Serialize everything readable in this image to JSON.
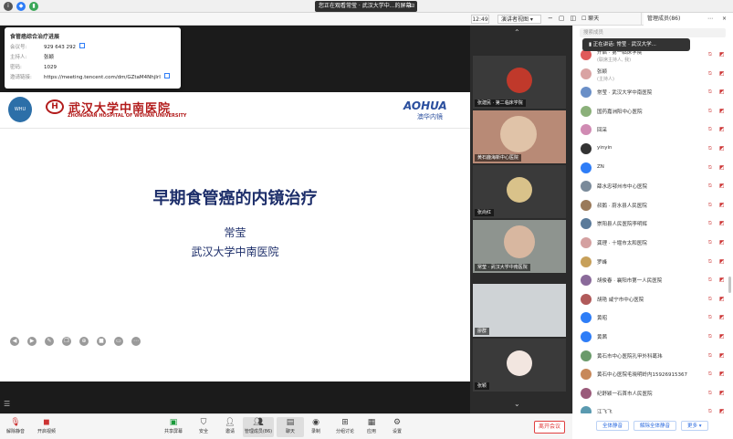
{
  "topbar": {
    "banner": "您正在观看常莹 · 武汉大学中...的屏幕",
    "time": "12:49",
    "view_btn": "演讲者视图",
    "chat_tab": "聊天",
    "members_tab": "管理成员(86)"
  },
  "info": {
    "title": "食管癌综合治疗进展",
    "rows": [
      {
        "k": "会议号:",
        "v": "929 643 292"
      },
      {
        "k": "主持人:",
        "v": "张颖"
      },
      {
        "k": "密码:",
        "v": "1029"
      },
      {
        "k": "邀请链接:",
        "v": "https://meeting.tencent.com/dm/GZtaM4NhjIrI"
      }
    ]
  },
  "slide": {
    "hospital_cn": "武汉大学中南医院",
    "hospital_en": "ZHONGNAN HOSPITAL OF WUHAN UNIVERSITY",
    "logo_en": "AOHUA",
    "logo_cn": "澳华内镜",
    "title": "早期食管癌的内镜治疗",
    "author": "常莹",
    "institution": "武汉大学中南医院"
  },
  "videos": [
    {
      "name": "张建民 · 第二临床学院",
      "avatar_color": "#c0392b"
    },
    {
      "name": "黄石鹿海新中心医院"
    },
    {
      "name": "张尚红"
    },
    {
      "name": "常莹 · 武汉大学中南医院"
    },
    {
      "name": "廖群"
    },
    {
      "name": "张颖"
    }
  ],
  "panel": {
    "search_placeholder": "搜索成员",
    "speaking": "正在讲话: 常莹 · 武汉大学...",
    "members": [
      {
        "name": "开启 · 第一临床学院",
        "sub": "(联席主持人, 我)",
        "color": "#e05a5a"
      },
      {
        "name": "张颖",
        "sub": "(主持人)",
        "color": "#d9a3a3"
      },
      {
        "name": "常莹 · 武汉大学中南医院",
        "sub": "",
        "color": "#6a8fc7"
      },
      {
        "name": "国药嘉洲阳中心医院",
        "sub": "",
        "color": "#8bb07a"
      },
      {
        "name": "回采",
        "sub": "",
        "color": "#d08bb3"
      },
      {
        "name": "yinyin",
        "sub": "",
        "color": "#333333"
      },
      {
        "name": "ZN",
        "sub": "",
        "color": "#2e7df7"
      },
      {
        "name": "薛水忠鄂州市中心医院",
        "sub": "",
        "color": "#7a8a9a"
      },
      {
        "name": "叔鹅 · 蔚水县人民医院",
        "sub": "",
        "color": "#9a7a5a"
      },
      {
        "name": "崇阳县人民医院李明辉",
        "sub": "",
        "color": "#5a7a9a"
      },
      {
        "name": "龚理 · 十堰市太和医院",
        "sub": "",
        "color": "#d4a0a0"
      },
      {
        "name": "罗峰",
        "sub": "",
        "color": "#c7a05a"
      },
      {
        "name": "胡俊春 · 襄阳市第一人民医院",
        "sub": "",
        "color": "#8a6a9a"
      },
      {
        "name": "胡艳 咸宁市中心医院",
        "sub": "",
        "color": "#b05a5a"
      },
      {
        "name": "黄昭",
        "sub": "",
        "color": "#2e7df7"
      },
      {
        "name": "黄茜",
        "sub": "",
        "color": "#2e7df7"
      },
      {
        "name": "黄石市中心医院孔甲外科葛玮",
        "sub": "",
        "color": "#6a9a6a"
      },
      {
        "name": "黄石中心医院毛晓明岭内15926915367",
        "sub": "",
        "color": "#c7885a"
      },
      {
        "name": "纪舒颖一石首市人民医院",
        "sub": "",
        "color": "#9a5a7a"
      },
      {
        "name": "江飞飞",
        "sub": "",
        "color": "#5a9ab0"
      }
    ],
    "btn_mute_all": "全体静音",
    "btn_unmute_all": "解除全体静音",
    "btn_more": "更多"
  },
  "bottom": {
    "unmute": "解除静音",
    "video": "开启视频",
    "share": "共享屏幕",
    "security": "安全",
    "invite": "邀请",
    "members": "管理成员(86)",
    "chat": "聊天",
    "record": "录制",
    "breakout": "分组讨论",
    "apps": "应用",
    "settings": "设置",
    "leave": "离开会议"
  }
}
